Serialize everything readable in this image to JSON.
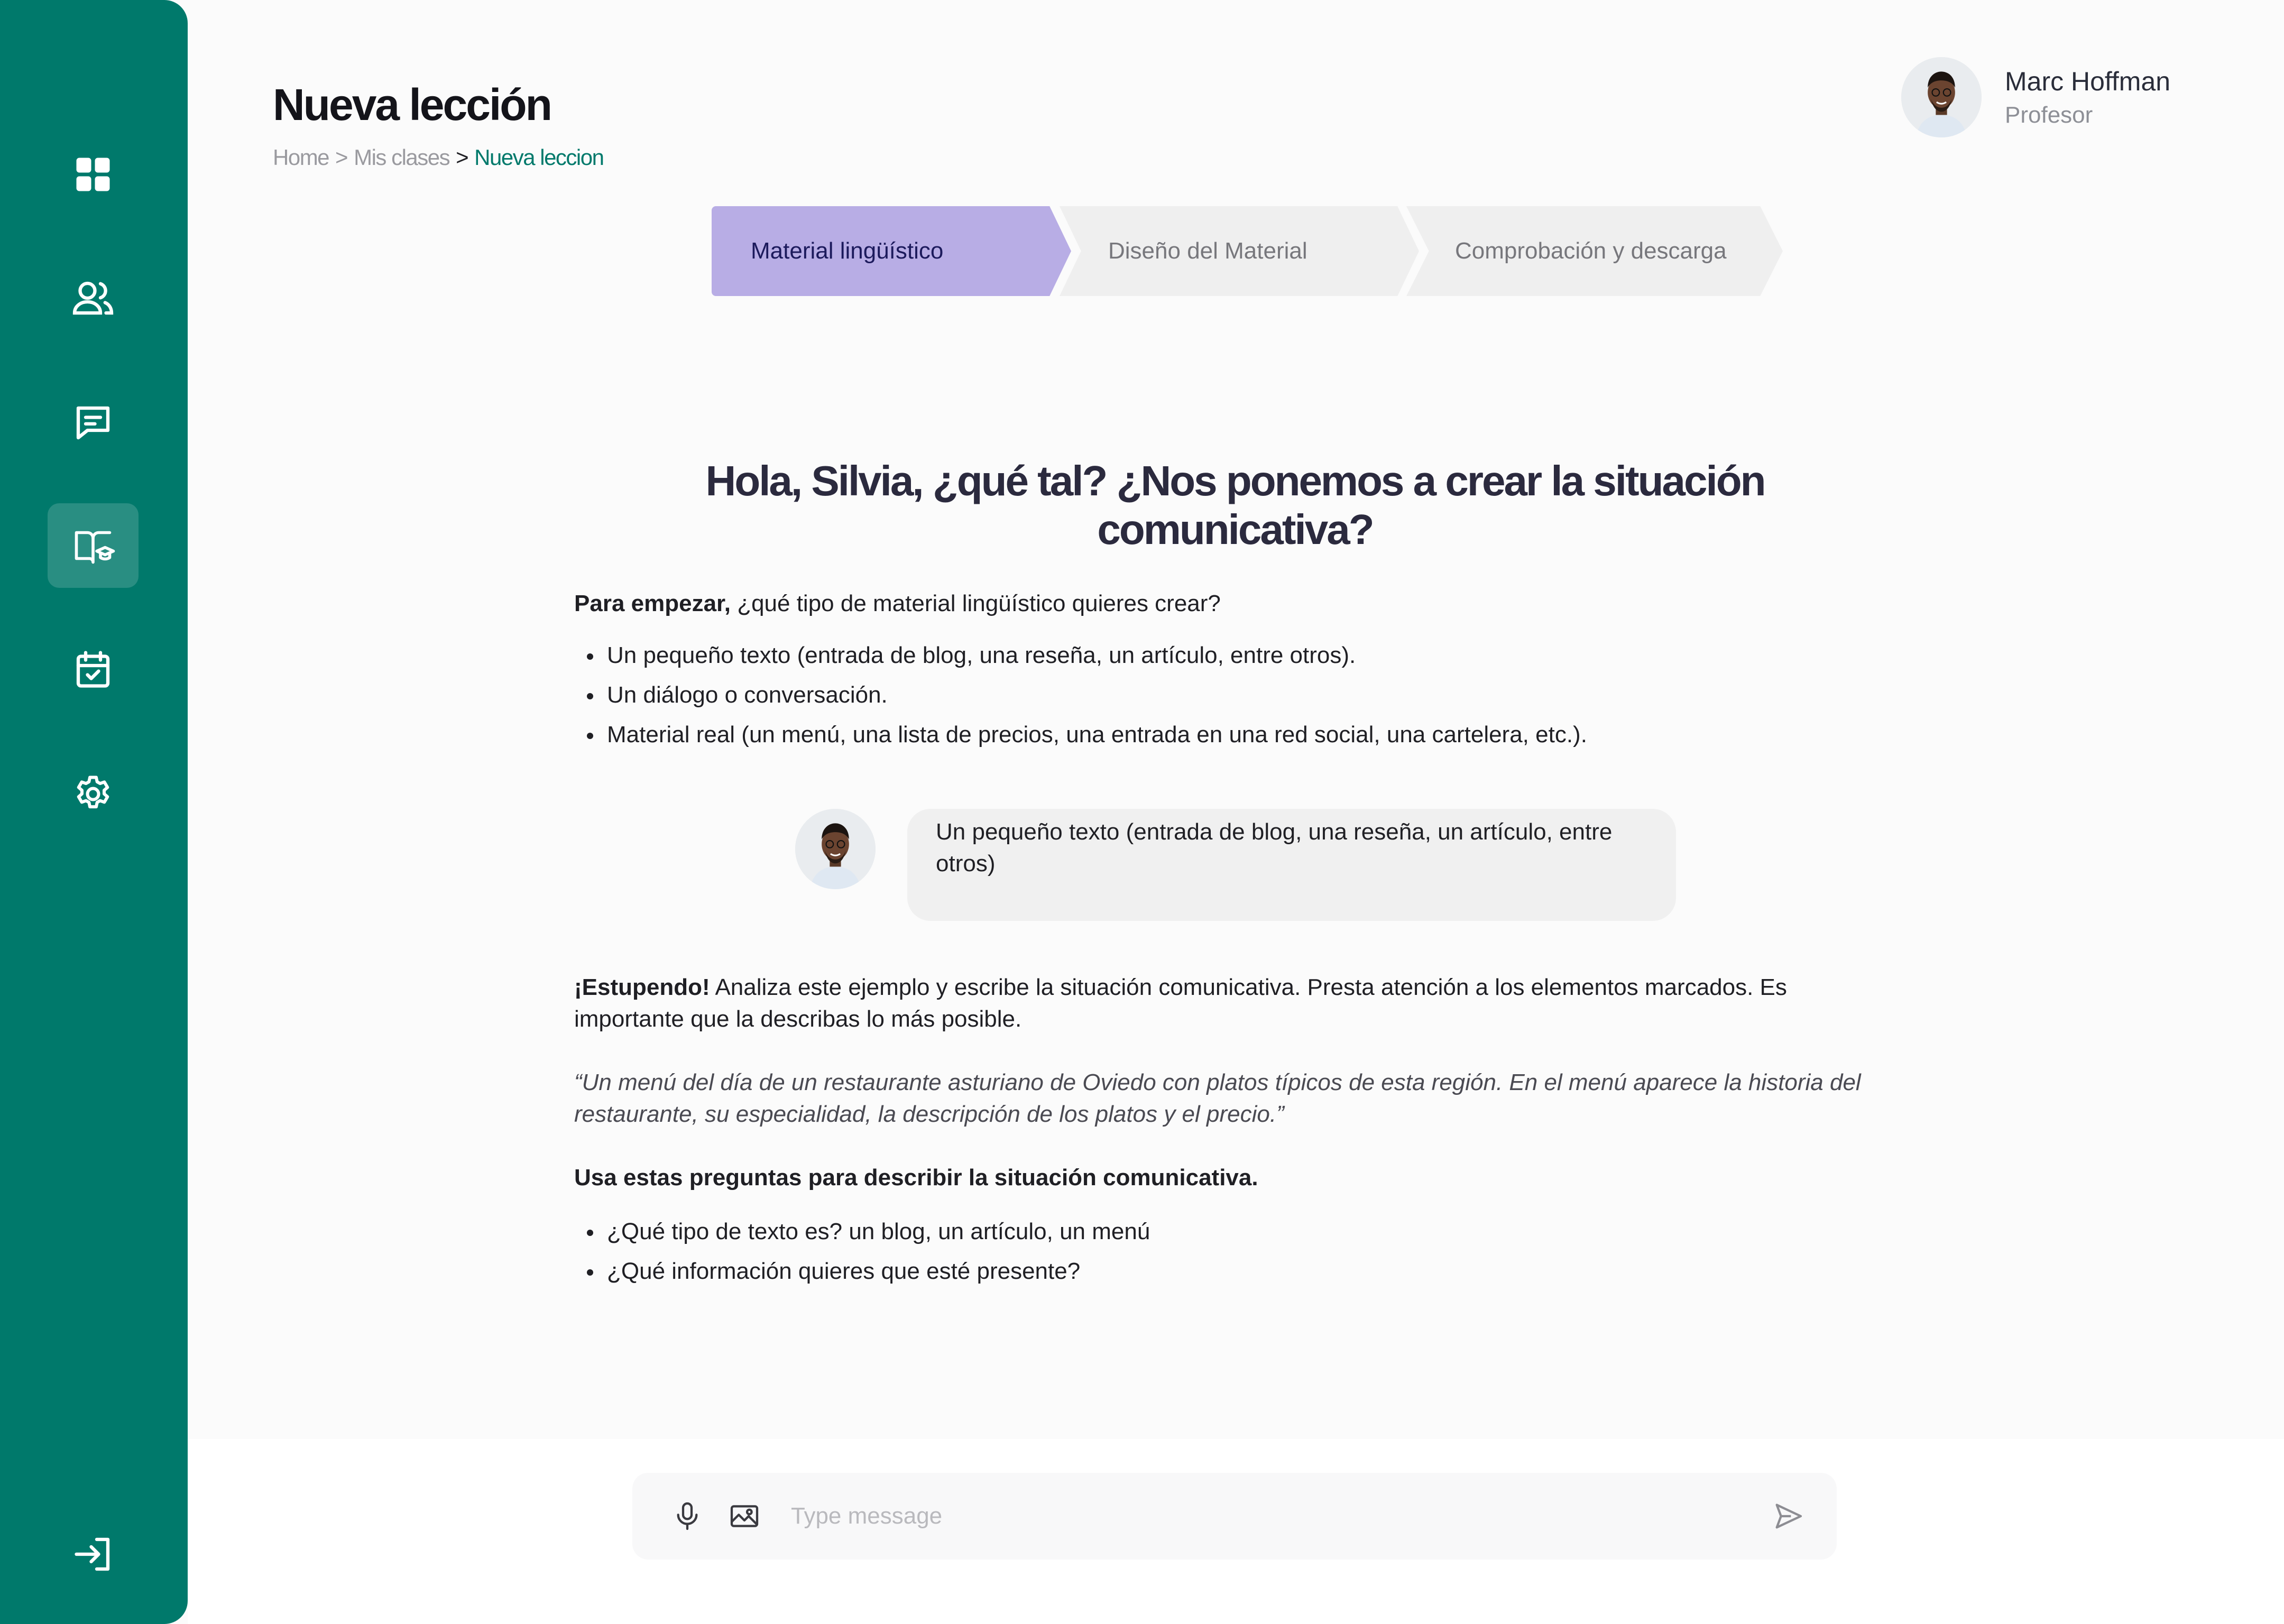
{
  "colors": {
    "sidebar": "#00796b",
    "accent": "#00796b",
    "active_step": "#b8ade5",
    "inactive_step": "#efefef"
  },
  "sidebar": {
    "items": [
      {
        "icon": "dashboard-icon",
        "active": false
      },
      {
        "icon": "users-icon",
        "active": false
      },
      {
        "icon": "chat-icon",
        "active": false
      },
      {
        "icon": "lessons-book-icon",
        "active": true
      },
      {
        "icon": "calendar-check-icon",
        "active": false
      },
      {
        "icon": "settings-gear-icon",
        "active": false
      }
    ],
    "logout_icon": "logout-icon"
  },
  "header": {
    "title": "Nueva lección",
    "breadcrumb": {
      "home": "Home",
      "separator": ">",
      "classes": "Mis clases",
      "current": "Nueva leccion"
    }
  },
  "profile": {
    "name": "Marc Hoffman",
    "role": "Profesor"
  },
  "steps": [
    {
      "label": "Material lingüístico",
      "active": true
    },
    {
      "label": "Diseño del Material",
      "active": false
    },
    {
      "label": "Comprobación y descarga",
      "active": false
    }
  ],
  "content": {
    "headline": "Hola, Silvia, ¿qué tal? ¿Nos ponemos a crear la situación comunicativa?",
    "intro_bold": "Para empezar,",
    "intro_rest": " ¿qué tipo de material lingüístico quieres crear?",
    "options": [
      "Un pequeño texto (entrada de blog, una reseña, un artículo, entre otros).",
      "Un diálogo o conversación.",
      "Material real (un menú, una lista de precios, una entrada en una red social, una cartelera, etc.)."
    ],
    "user_reply": "Un pequeño texto (entrada de blog, una reseña, un artículo, entre otros)",
    "response_bold": "¡Estupendo!",
    "response_rest": " Analiza este ejemplo y escribe la situación comunicativa. Presta atención a los elementos marcados. Es importante que la describas lo más posible.",
    "example_quote": "“Un menú del día de un restaurante asturiano de Oviedo con platos típicos de esta región. En el menú aparece la historia del restaurante, su especialidad, la descripción de los platos y el precio.”",
    "questions_heading": "Usa estas preguntas para describir la situación comunicativa.",
    "questions": [
      "¿Qué tipo de texto es? un blog, un artículo, un menú",
      "¿Qué información quieres que esté presente?"
    ]
  },
  "composer": {
    "placeholder": "Type message",
    "value": ""
  }
}
